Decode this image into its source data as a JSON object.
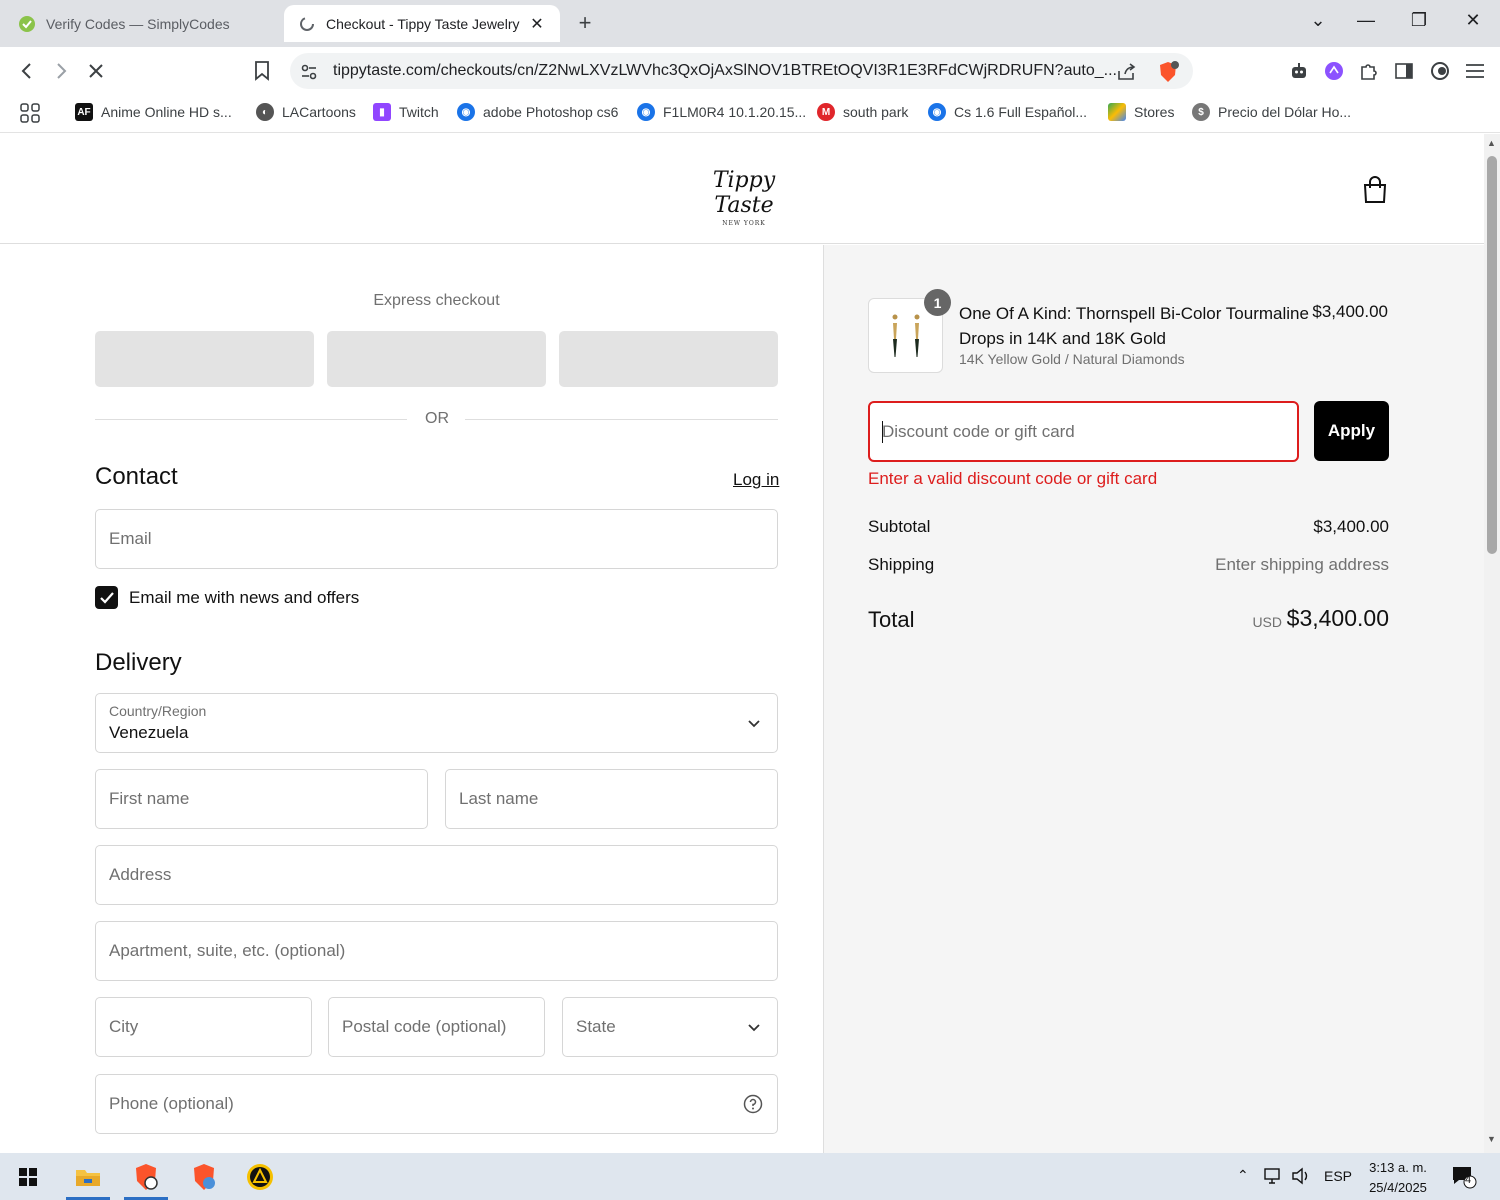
{
  "browser": {
    "tabs": [
      {
        "title": "Verify Codes — SimplyCodes",
        "active": false
      },
      {
        "title": "Checkout - Tippy Taste Jewelry",
        "active": true
      }
    ],
    "url": "tippytaste.com/checkouts/cn/Z2NwLXVzLWVhc3QxOjAxSlNOV1BTREtOQVI3R1E3RFdCWjRDRUFN?auto_...",
    "extension_badge": "3",
    "bookmarks": [
      {
        "label": "Anime Online HD s...",
        "icon": "AF",
        "color": "#111111"
      },
      {
        "label": "LACartoons",
        "icon": "globe",
        "color": "#555555"
      },
      {
        "label": "Twitch",
        "icon": "twitch",
        "color": "#9146ff"
      },
      {
        "label": "adobe Photoshop cs6",
        "icon": "swirl",
        "color": "#1a73e8"
      },
      {
        "label": "F1LM0R4 10.1.20.15...",
        "icon": "swirl",
        "color": "#1a73e8"
      },
      {
        "label": "south park",
        "icon": "M",
        "color": "#e0262b"
      },
      {
        "label": "Cs 1.6 Full Español...",
        "icon": "swirl",
        "color": "#1a73e8"
      },
      {
        "label": "Stores",
        "icon": "stores",
        "color": "#34a853"
      },
      {
        "label": "Precio del Dólar Ho...",
        "icon": "dollar",
        "color": "#555555"
      }
    ]
  },
  "store": {
    "logo_text": "Tippy Taste",
    "logo_sub": "NEW YORK"
  },
  "checkout": {
    "express_title": "Express checkout",
    "or_text": "OR",
    "contact_heading": "Contact",
    "login_link": "Log in",
    "email_placeholder": "Email",
    "news_checkbox_label": "Email me with news and offers",
    "news_checked": true,
    "delivery_heading": "Delivery",
    "country_label": "Country/Region",
    "country_value": "Venezuela",
    "first_name_placeholder": "First name",
    "last_name_placeholder": "Last name",
    "address_placeholder": "Address",
    "apartment_placeholder": "Apartment, suite, etc. (optional)",
    "city_placeholder": "City",
    "postal_placeholder": "Postal code (optional)",
    "state_placeholder": "State",
    "phone_placeholder": "Phone (optional)"
  },
  "summary": {
    "product_qty": "1",
    "product_name": "One Of A Kind: Thornspell Bi-Color Tourmaline Drops in 14K and 18K Gold",
    "product_variant": "14K Yellow Gold / Natural Diamonds",
    "product_price": "$3,400.00",
    "discount_placeholder": "Discount code or gift card",
    "apply_label": "Apply",
    "discount_error": "Enter a valid discount code or gift card",
    "subtotal_label": "Subtotal",
    "subtotal_value": "$3,400.00",
    "shipping_label": "Shipping",
    "shipping_value": "Enter shipping address",
    "total_label": "Total",
    "total_currency": "USD",
    "total_value": "$3,400.00",
    "error_color": "#dd1d1d"
  },
  "taskbar": {
    "language": "ESP",
    "time": "3:13 a. m.",
    "date": "25/4/2025",
    "notification_count": "4"
  }
}
